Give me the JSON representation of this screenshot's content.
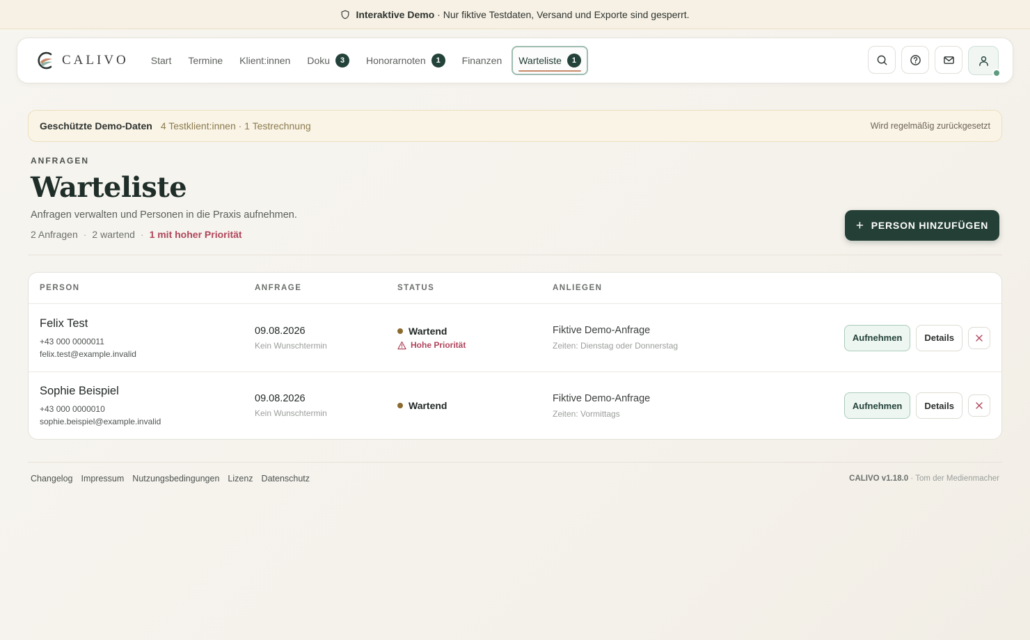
{
  "banner": {
    "title": "Interaktive Demo",
    "text": "· Nur fiktive Testdaten, Versand und Exporte sind gesperrt."
  },
  "brand": {
    "name": "CALIVO"
  },
  "nav": [
    {
      "label": "Start",
      "badge": null,
      "active": false
    },
    {
      "label": "Termine",
      "badge": null,
      "active": false
    },
    {
      "label": "Klient:innen",
      "badge": null,
      "active": false
    },
    {
      "label": "Doku",
      "badge": "3",
      "active": false
    },
    {
      "label": "Honorarnoten",
      "badge": "1",
      "active": false
    },
    {
      "label": "Finanzen",
      "badge": null,
      "active": false
    },
    {
      "label": "Warteliste",
      "badge": "1",
      "active": true
    }
  ],
  "actions": [
    "search-icon",
    "help-icon",
    "mail-icon",
    "user-icon"
  ],
  "demo_info": {
    "title": "Geschützte Demo-Daten",
    "meta": "4 Testklient:innen · 1 Testrechnung",
    "right": "Wird regelmäßig zurückgesetzt"
  },
  "page": {
    "eyebrow": "ANFRAGEN",
    "title": "Warteliste",
    "subtitle": "Anfragen verwalten und Personen in die Praxis aufnehmen.",
    "stat_requests": "2 Anfragen",
    "stat_waiting": "2 wartend",
    "stat_priority": "1 mit hoher Priorität",
    "add_button": "PERSON HINZUFÜGEN"
  },
  "table": {
    "headers": {
      "person": "PERSON",
      "anfrage": "ANFRAGE",
      "status": "STATUS",
      "anliegen": "ANLIEGEN"
    },
    "rows": [
      {
        "name": "Felix Test",
        "phone": "+43 000 0000011",
        "email": "felix.test@example.invalid",
        "date": "09.08.2026",
        "date_note": "Kein Wunschtermin",
        "status": "Wartend",
        "priority": "Hohe Priorität",
        "concern": "Fiktive Demo-Anfrage",
        "times": "Zeiten: Dienstag oder Donnerstag"
      },
      {
        "name": "Sophie Beispiel",
        "phone": "+43 000 0000010",
        "email": "sophie.beispiel@example.invalid",
        "date": "09.08.2026",
        "date_note": "Kein Wunschtermin",
        "status": "Wartend",
        "priority": null,
        "concern": "Fiktive Demo-Anfrage",
        "times": "Zeiten: Vormittags"
      }
    ],
    "accept_label": "Aufnehmen",
    "details_label": "Details"
  },
  "footer": {
    "links": [
      "Changelog",
      "Impressum",
      "Nutzungsbedingungen",
      "Lizenz",
      "Datenschutz"
    ],
    "version": "CALIVO v1.18.0",
    "author": " · Tom der Medienmacher"
  },
  "colors": {
    "primary": "#243f36",
    "accent": "#c8896b",
    "priority": "#b0455b",
    "waiting": "#8a6a2e"
  }
}
